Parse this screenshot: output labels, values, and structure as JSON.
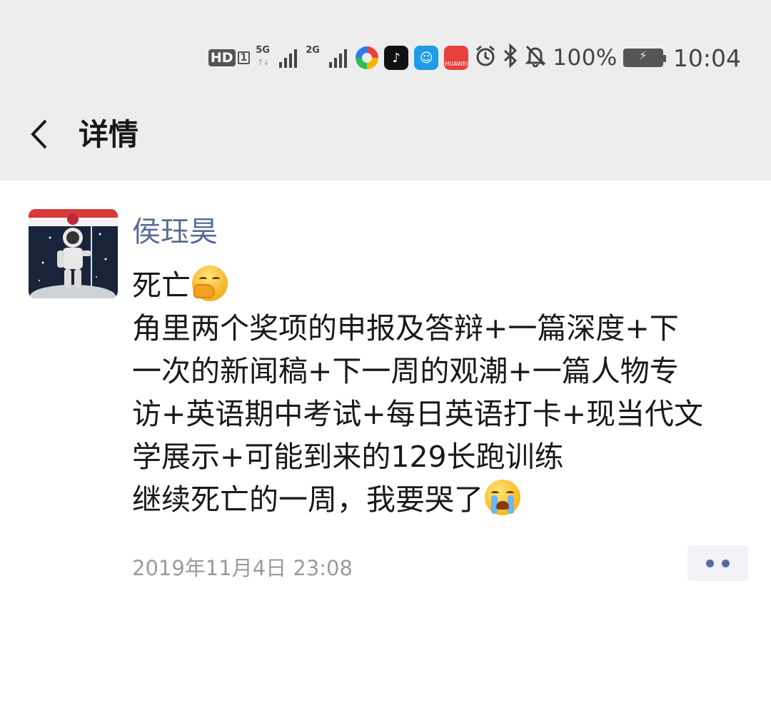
{
  "status_bar": {
    "hd": "HD",
    "hd_sub": "1",
    "signal1_label": "5G",
    "signal2_label": "2G",
    "apps": [
      {
        "icon": "colorful-circle-app-icon"
      },
      {
        "icon": "tiktok-app-icon",
        "glyph": "♪"
      },
      {
        "icon": "blue-app-icon",
        "glyph": "☺"
      },
      {
        "icon": "huawei-appgallery-icon",
        "text": "HUAWEI"
      }
    ],
    "alarm_icon": "⏰",
    "bluetooth_icon": "bluetooth",
    "mute_icon": "bell-off",
    "battery_percent": "100%",
    "time": "10:04"
  },
  "header": {
    "back_icon": "chevron-left",
    "title": "详情"
  },
  "post": {
    "author": "侯珏昊",
    "lines": [
      "死亡",
      "角里两个奖项的申报及答辩+一篇深度+下",
      "一次的新闻稿+下一周的观潮+一篇人物专",
      "访+英语期中考试+每日英语打卡+现当代文",
      "学展示+可能到来的129长跑训练",
      "继续死亡的一周，我要哭了"
    ],
    "emojis": [
      "facepalm-emoji",
      "loudly-crying-emoji"
    ],
    "timestamp": "2019年11月4日 23:08"
  },
  "colors": {
    "header_bg": "#ededed",
    "author_link": "#576b95",
    "body_text": "#191919",
    "timestamp": "#9b9b9b",
    "more_button_bg": "#f1f2f6"
  }
}
